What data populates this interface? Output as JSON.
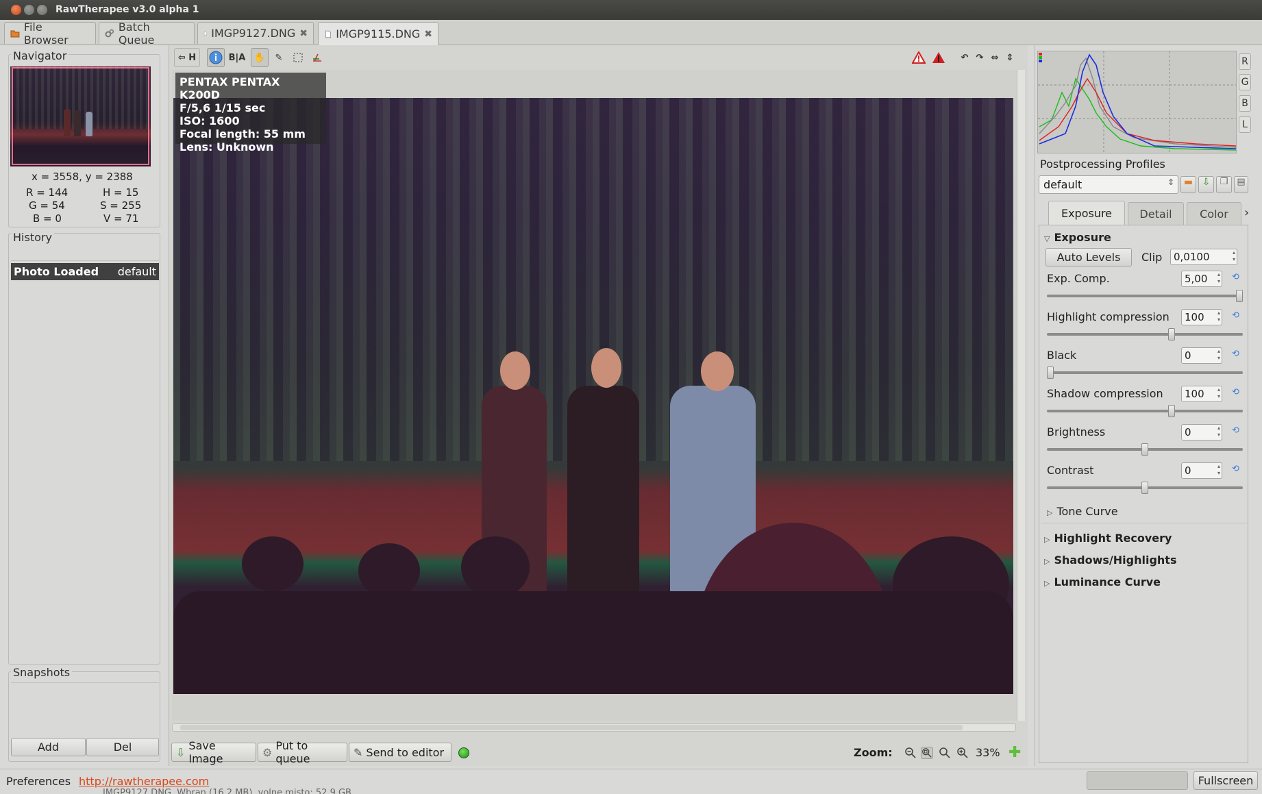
{
  "window": {
    "title": "RawTherapee v3.0 alpha 1"
  },
  "tabs": [
    {
      "label": "File Browser"
    },
    {
      "label": "Batch Queue"
    },
    {
      "label": "IMGP9127.DNG"
    },
    {
      "label": "IMGP9115.DNG"
    }
  ],
  "navigator": {
    "title": "Navigator",
    "coords": "x = 3558, y = 2388",
    "r": "R = 144",
    "h": "H = 15",
    "g": "G = 54",
    "s": "S = 255",
    "b": "B = 0",
    "v": "V = 71"
  },
  "history": {
    "title": "History",
    "row_label": "Photo Loaded",
    "row_value": "default"
  },
  "snapshots": {
    "title": "Snapshots",
    "add": "Add",
    "del": "Del"
  },
  "toolbar": {
    "h_label": "H",
    "ba_label": "B|A"
  },
  "exif": {
    "camera": "PENTAX PENTAX K200D",
    "exposure": "F/5,6 1/15 sec",
    "iso": "ISO: 1600",
    "focal": "Focal length: 55 mm",
    "lens": "Lens: Unknown"
  },
  "bottom": {
    "save": "Save Image",
    "queue": "Put to queue",
    "editor": "Send to editor",
    "zoom_label": "Zoom:",
    "zoom_value": "33%"
  },
  "histogram": {
    "buttons": [
      "R",
      "G",
      "B",
      "L"
    ]
  },
  "profiles": {
    "title": "Postprocessing Profiles",
    "selected": "default"
  },
  "right_tabs": [
    {
      "label": "Exposure"
    },
    {
      "label": "Detail"
    },
    {
      "label": "Color"
    }
  ],
  "exposure": {
    "header": "Exposure",
    "auto_levels": "Auto Levels",
    "clip_label": "Clip",
    "clip_value": "0,0100",
    "params": [
      {
        "label": "Exp. Comp.",
        "value": "5,00",
        "level": 1.0
      },
      {
        "label": "Highlight compression",
        "value": "100",
        "level": 0.64
      },
      {
        "label": "Black",
        "value": "0",
        "level": 0.0
      },
      {
        "label": "Shadow compression",
        "value": "100",
        "level": 0.64
      },
      {
        "label": "Brightness",
        "value": "0",
        "level": 0.5
      },
      {
        "label": "Contrast",
        "value": "0",
        "level": 0.5
      }
    ],
    "tone_curve": "Tone Curve"
  },
  "sections": [
    "Highlight Recovery",
    "Shadows/Highlights",
    "Luminance Curve"
  ],
  "status": {
    "preferences": "Preferences",
    "link": "http://rawtherapee.com",
    "fullscreen": "Fullscreen",
    "behind": "IMGP9127.DNG. Wbran (16.2 MB). volne misto: 52.9 GB"
  },
  "colors": {
    "accent_link": "#d7461a",
    "history_row": "#404040"
  }
}
